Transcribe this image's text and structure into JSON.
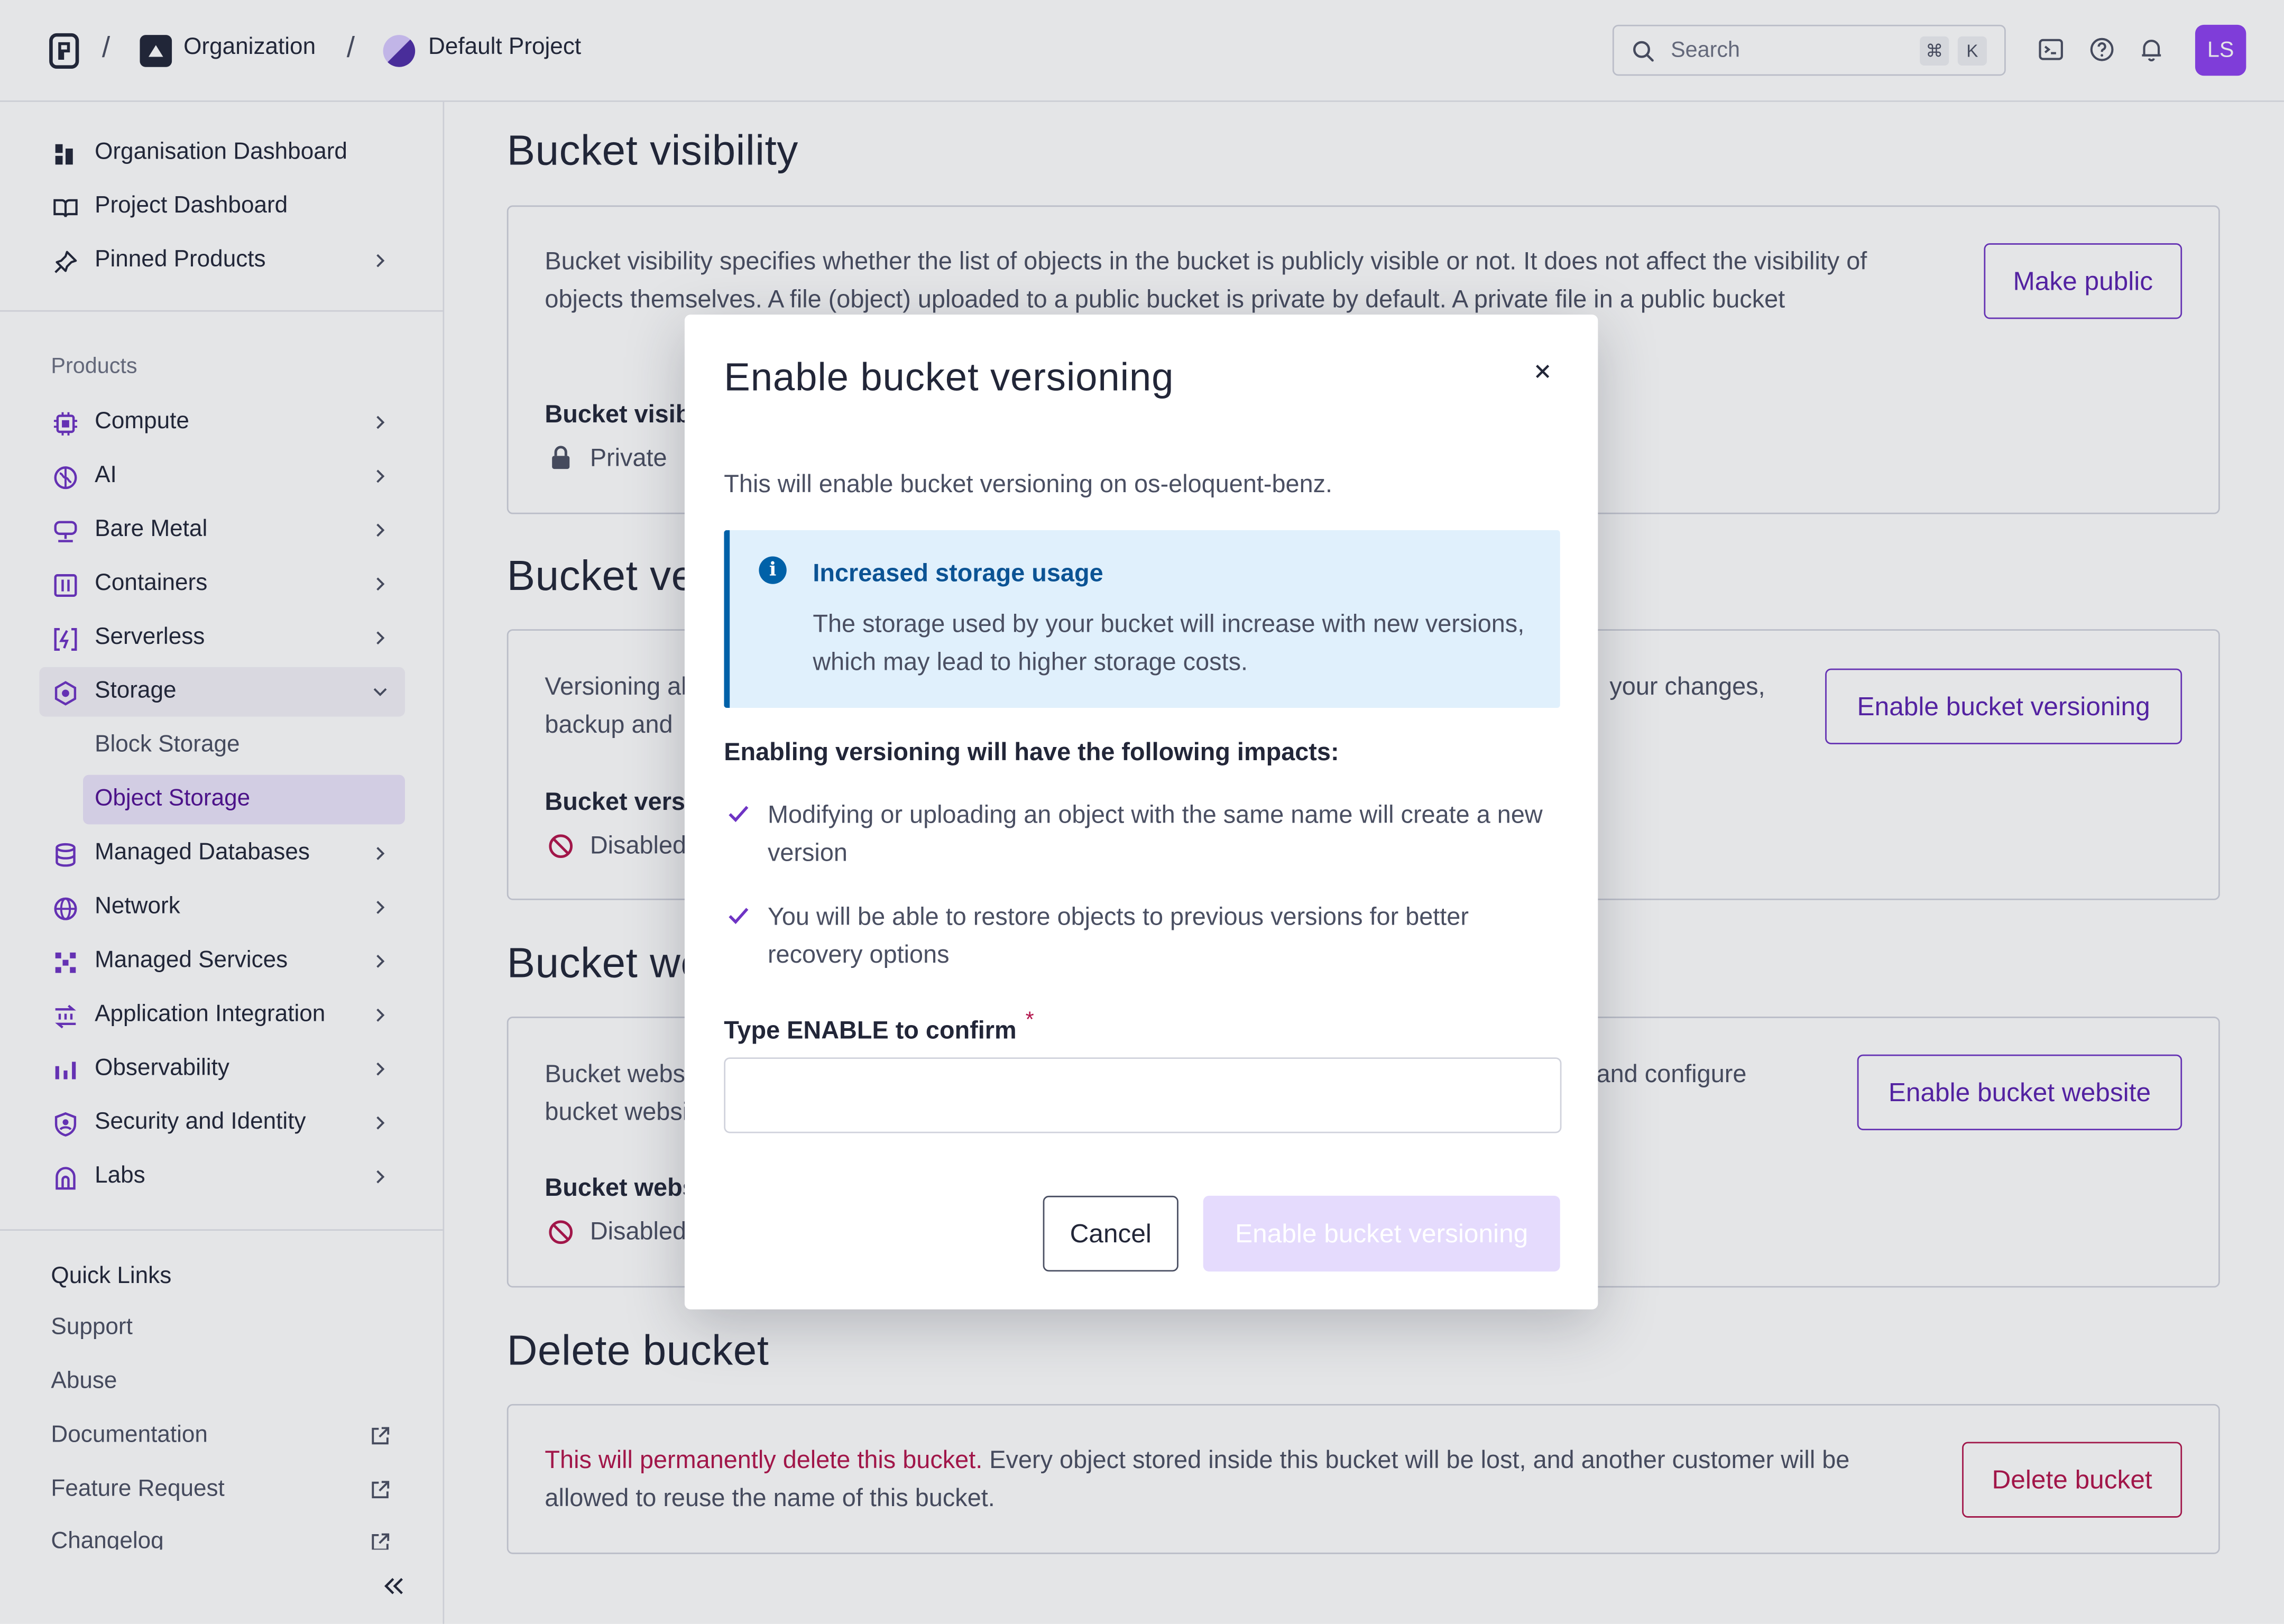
{
  "header": {
    "org_label": "Organization",
    "project_label": "Default Project",
    "search_placeholder": "Search",
    "kbd_cmd": "⌘",
    "kbd_k": "K",
    "avatar_initials": "LS"
  },
  "sidebar": {
    "top_items": [
      {
        "label": "Organisation Dashboard"
      },
      {
        "label": "Project Dashboard"
      },
      {
        "label": "Pinned Products"
      }
    ],
    "products_title": "Products",
    "products": [
      {
        "label": "Compute"
      },
      {
        "label": "AI"
      },
      {
        "label": "Bare Metal"
      },
      {
        "label": "Containers"
      },
      {
        "label": "Serverless"
      },
      {
        "label": "Storage"
      },
      {
        "label": "Managed Databases"
      },
      {
        "label": "Network"
      },
      {
        "label": "Managed Services"
      },
      {
        "label": "Application Integration"
      },
      {
        "label": "Observability"
      },
      {
        "label": "Security and Identity"
      },
      {
        "label": "Labs"
      }
    ],
    "storage_sub": [
      {
        "label": "Block Storage"
      },
      {
        "label": "Object Storage"
      }
    ],
    "quick_links_title": "Quick Links",
    "quick_links": [
      {
        "label": "Support"
      },
      {
        "label": "Abuse"
      },
      {
        "label": "Documentation"
      },
      {
        "label": "Feature Request"
      },
      {
        "label": "Changelog"
      }
    ]
  },
  "main": {
    "visibility": {
      "title": "Bucket visibility",
      "desc": "Bucket visibility specifies whether the list of objects in the bucket is publicly visible or not. It does not affect the visibility of objects themselves. A file (object) uploaded to a public bucket is private by default. A private file in a public bucket",
      "label": "Bucket visibility",
      "status": "Private",
      "button": "Make public"
    },
    "versioning": {
      "title": "Bucket versioning",
      "desc_left": "Versioning allows",
      "desc_left2": "backup and",
      "desc_right": "your changes,",
      "label": "Bucket versioning",
      "status": "Disabled",
      "button": "Enable bucket versioning"
    },
    "website": {
      "title": "Bucket website",
      "desc_left": "Bucket website",
      "desc_left2": "bucket website",
      "desc_right": "and configure",
      "label": "Bucket website",
      "status": "Disabled",
      "button": "Enable bucket website"
    },
    "delete": {
      "title": "Delete bucket",
      "warn": "This will permanently delete this bucket.",
      "desc": " Every object stored inside this bucket will be lost, and another customer will be allowed to reuse the name of this bucket.",
      "button": "Delete bucket"
    }
  },
  "modal": {
    "title": "Enable bucket versioning",
    "subtitle": "This will enable bucket versioning on os-eloquent-benz.",
    "alert_title": "Increased storage usage",
    "alert_body": "The storage used by your bucket will increase with new versions, which may lead to higher storage costs.",
    "impacts_title": "Enabling versioning will have the following impacts:",
    "impacts": [
      "Modifying or uploading an object with the same name will create a new version",
      "You will be able to restore objects to previous versions for better recovery options"
    ],
    "confirm_label": "Type ENABLE to confirm",
    "required_mark": "*",
    "input_value": "",
    "cancel_label": "Cancel",
    "confirm_button": "Enable bucket versioning"
  },
  "colors": {
    "accent": "#5b22b0",
    "danger": "#b3144c",
    "info": "#0061a8",
    "info_bg": "#e0f0fc",
    "disabled_button": "#e5dbfd"
  }
}
